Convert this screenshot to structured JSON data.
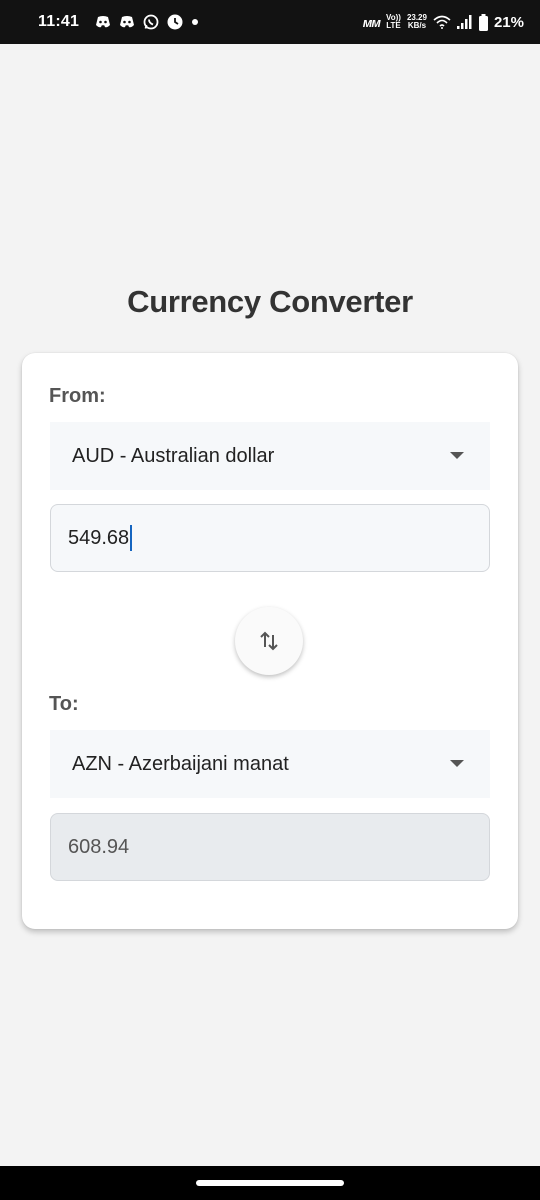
{
  "status_bar": {
    "time": "11:41",
    "notification_icons": [
      "discord-icon",
      "discord-icon",
      "whatsapp-icon",
      "timer-app-icon",
      "dot-icon"
    ],
    "carrier_badge": "ᴍ",
    "volte_top": "Vo))",
    "volte_bottom": "LTE",
    "speed_value": "23.29",
    "speed_unit": "KB/s",
    "battery": "21%"
  },
  "app": {
    "title": "Currency Converter"
  },
  "converter": {
    "from_label": "From:",
    "from_currency": "AUD - Australian dollar",
    "amount_input": "549.68",
    "swap_icon": "swap-vertical-icon",
    "to_label": "To:",
    "to_currency": "AZN - Azerbaijani manat",
    "converted_amount": "608.94"
  },
  "colors": {
    "background": "#f3f3f3",
    "card": "#ffffff",
    "status_bar": "#121212",
    "cursor": "#1565c0"
  }
}
